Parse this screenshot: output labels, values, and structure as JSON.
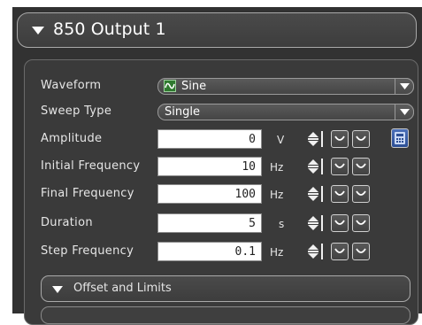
{
  "section": {
    "title": "850 Output 1"
  },
  "labels": {
    "waveform": "Waveform",
    "sweep_type": "Sweep Type",
    "amplitude": "Amplitude",
    "initial_frequency": "Initial Frequency",
    "final_frequency": "Final Frequency",
    "duration": "Duration",
    "step_frequency": "Step Frequency"
  },
  "waveform": {
    "value": "Sine",
    "icon": "sine-wave-icon"
  },
  "sweep_type": {
    "value": "Single"
  },
  "params": {
    "amplitude": {
      "value": "0",
      "unit": "V"
    },
    "initial_frequency": {
      "value": "10",
      "unit": "Hz"
    },
    "final_frequency": {
      "value": "100",
      "unit": "Hz"
    },
    "duration": {
      "value": "5",
      "unit": "s"
    },
    "step_frequency": {
      "value": "0.1",
      "unit": "Hz"
    }
  },
  "subsection": {
    "title": "Offset and Limits"
  },
  "colors": {
    "background": "#323232",
    "header_border": "#a9a9a9",
    "field_background": "#ffffff",
    "calculator_button": "#3d5fa8",
    "waveform_icon": "#2f7a2f"
  }
}
